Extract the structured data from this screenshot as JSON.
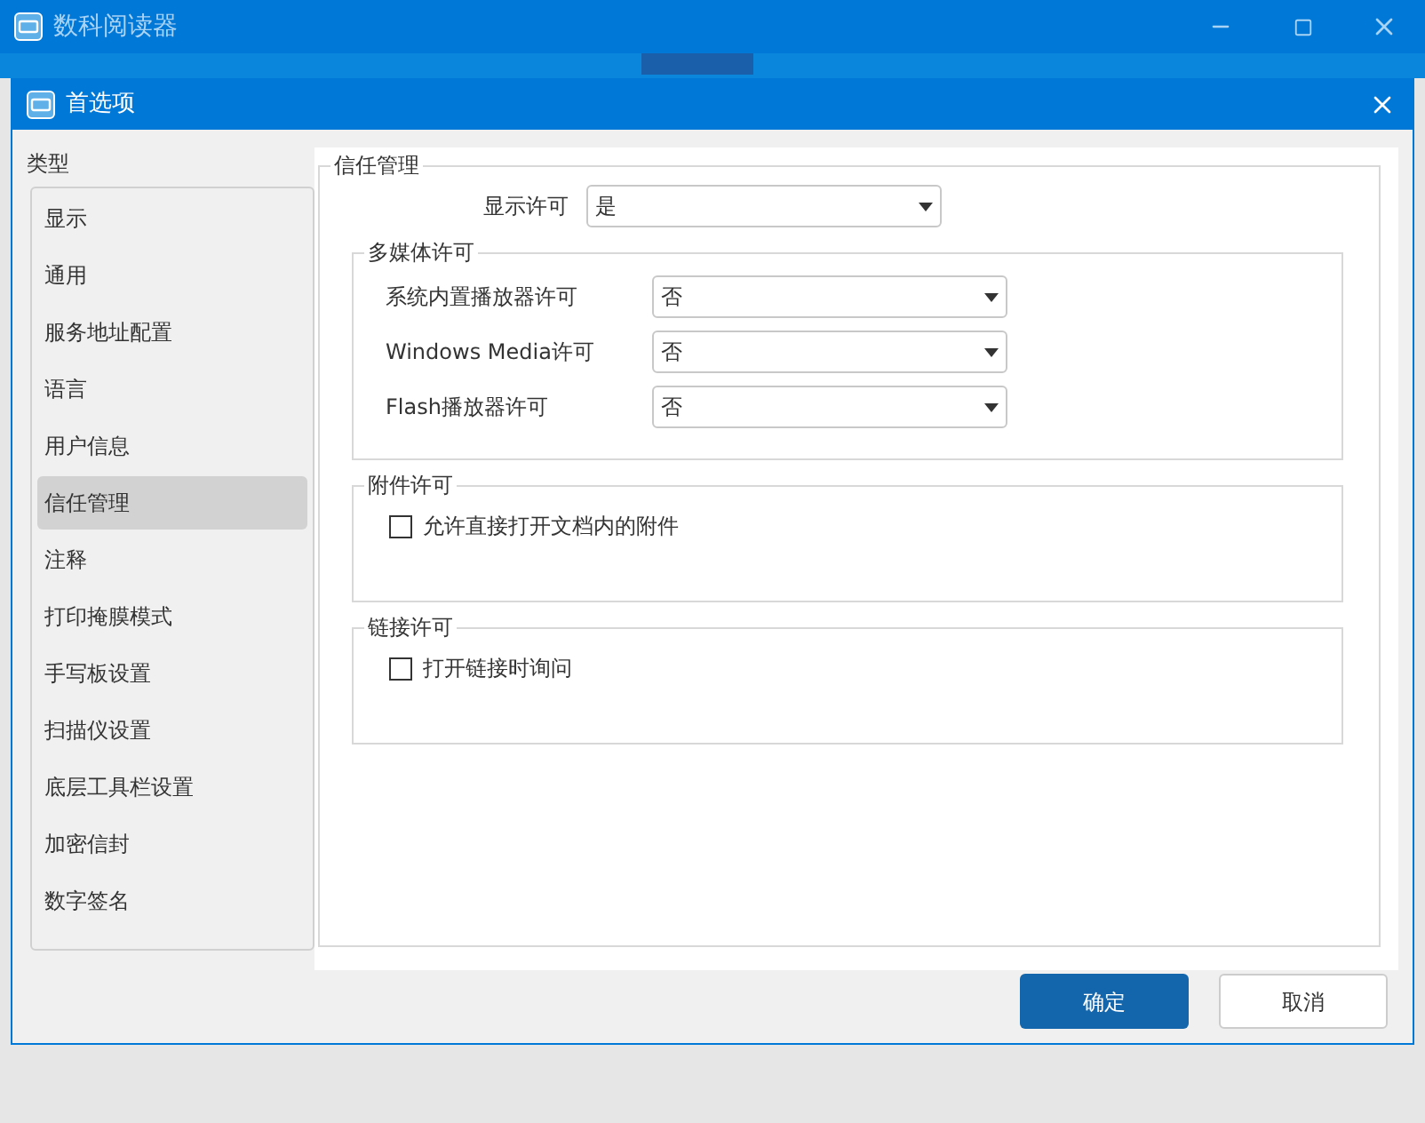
{
  "app_window": {
    "title": "数科阅读器"
  },
  "dialog": {
    "title": "首选项",
    "sidebar": {
      "heading": "类型",
      "items": [
        {
          "label": "显示",
          "selected": false
        },
        {
          "label": "通用",
          "selected": false
        },
        {
          "label": "服务地址配置",
          "selected": false
        },
        {
          "label": "语言",
          "selected": false
        },
        {
          "label": "用户信息",
          "selected": false
        },
        {
          "label": "信任管理",
          "selected": true
        },
        {
          "label": "注释",
          "selected": false
        },
        {
          "label": "打印掩膜模式",
          "selected": false
        },
        {
          "label": "手写板设置",
          "selected": false
        },
        {
          "label": "扫描仪设置",
          "selected": false
        },
        {
          "label": "底层工具栏设置",
          "selected": false
        },
        {
          "label": "加密信封",
          "selected": false
        },
        {
          "label": "数字签名",
          "selected": false
        }
      ]
    },
    "section": {
      "title": "信任管理",
      "display_permission": {
        "label": "显示许可",
        "value": "是"
      },
      "groups": [
        {
          "title": "多媒体许可",
          "kind": "selects",
          "rows": [
            {
              "label": "系统内置播放器许可",
              "value": "否"
            },
            {
              "label": "Windows Media许可",
              "value": "否"
            },
            {
              "label": "Flash播放器许可",
              "value": "否"
            }
          ]
        },
        {
          "title": "附件许可",
          "kind": "checkboxes",
          "rows": [
            {
              "label": "允许直接打开文档内的附件",
              "checked": false
            }
          ]
        },
        {
          "title": "链接许可",
          "kind": "checkboxes",
          "rows": [
            {
              "label": "打开链接时询问",
              "checked": false
            }
          ]
        }
      ]
    },
    "buttons": [
      {
        "label": "确定",
        "kind": "primary"
      },
      {
        "label": "取消",
        "kind": "secondary"
      }
    ]
  }
}
